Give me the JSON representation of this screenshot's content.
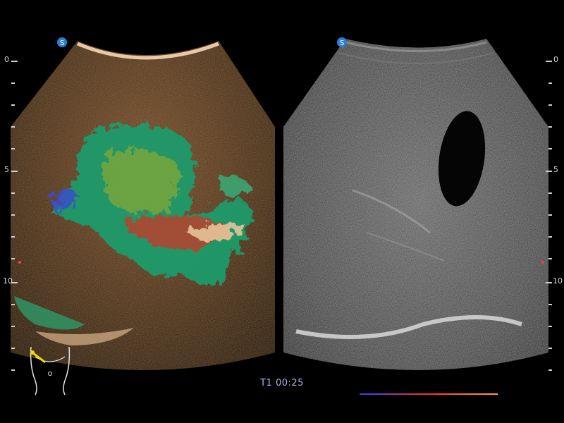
{
  "timer": {
    "label": "T1 00:25"
  },
  "depth_scale": {
    "left": {
      "labels": [
        "0",
        "5",
        "10"
      ]
    },
    "right": {
      "labels": [
        "0",
        "5",
        "10"
      ]
    }
  },
  "colors": {
    "background": "#000000",
    "timer_text": "#aab3e6",
    "scale_text": "#d8d8d8",
    "probe_icon": "#2a7fd4",
    "body_marker_probe": "#f5d800",
    "marker_dot": "#ff3a3a"
  },
  "icons": {
    "probe_left": "probe-orientation-icon",
    "probe_right": "probe-orientation-icon",
    "body_marker": "body-marker-icon"
  },
  "panels": {
    "left": {
      "mode": "contrast-color-overlay"
    },
    "right": {
      "mode": "b-mode-grayscale"
    }
  }
}
